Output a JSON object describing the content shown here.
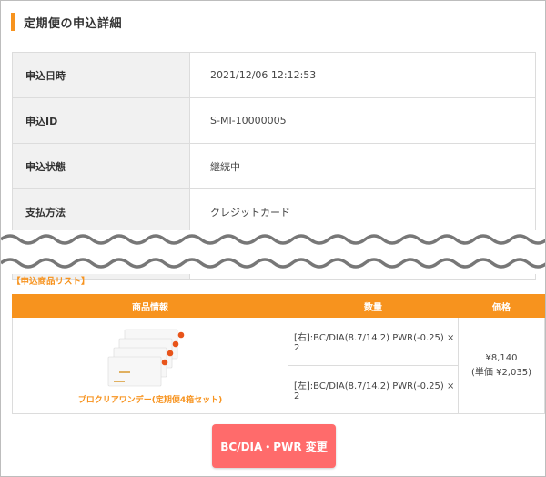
{
  "header": {
    "title": "定期便の申込詳細"
  },
  "details": [
    {
      "label": "申込日時",
      "value": "2021/12/06 12:12:53"
    },
    {
      "label": "申込ID",
      "value": "S-MI-10000005"
    },
    {
      "label": "申込状態",
      "value": "継続中"
    },
    {
      "label": "支払方法",
      "value": "クレジットカード"
    }
  ],
  "item_list": {
    "title": "【申込商品リスト】",
    "columns": [
      "商品情報",
      "数量",
      "価格"
    ],
    "rows": [
      {
        "product_name": "プロクリアワンデー(定期便4箱セット)",
        "quantities": [
          "[右]:BC/DIA(8.7/14.2) PWR(-0.25) × 2",
          "[左]:BC/DIA(8.7/14.2) PWR(-0.25) × 2"
        ],
        "price": "¥8,140",
        "unit_price": "(単価 ¥2,035)"
      }
    ]
  },
  "actions": {
    "change_button": "BC/DIA・PWR 変更"
  },
  "colors": {
    "accent": "#f7931e",
    "button": "#ff6b6b",
    "label_bg": "#f1f1f1",
    "border": "#dcdcdc"
  }
}
